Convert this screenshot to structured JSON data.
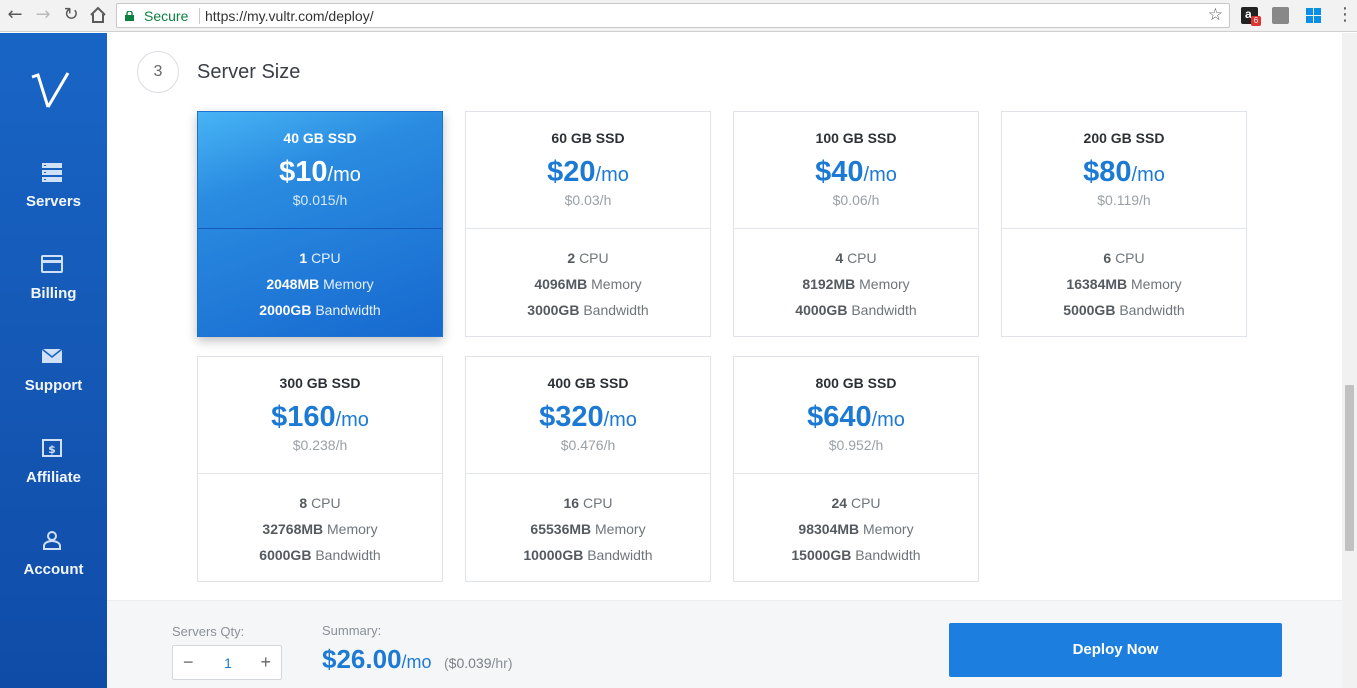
{
  "browser": {
    "secure_label": "Secure",
    "url": "https://my.vultr.com/deploy/",
    "extension_badge": "6"
  },
  "sidebar": {
    "items": [
      {
        "label": "Servers",
        "icon": "servers-icon"
      },
      {
        "label": "Billing",
        "icon": "credit-card-icon"
      },
      {
        "label": "Support",
        "icon": "envelope-icon"
      },
      {
        "label": "Affiliate",
        "icon": "dollar-bill-icon"
      },
      {
        "label": "Account",
        "icon": "user-icon"
      }
    ]
  },
  "section": {
    "step": "3",
    "title": "Server Size"
  },
  "plans": [
    {
      "ssd": "40 GB SSD",
      "price": "$10",
      "per": "/mo",
      "hourly": "$0.015/h",
      "cpu": "1",
      "cpu_label": "CPU",
      "memory": "2048MB",
      "memory_label": "Memory",
      "bandwidth": "2000GB",
      "bandwidth_label": "Bandwidth",
      "selected": true
    },
    {
      "ssd": "60 GB SSD",
      "price": "$20",
      "per": "/mo",
      "hourly": "$0.03/h",
      "cpu": "2",
      "cpu_label": "CPU",
      "memory": "4096MB",
      "memory_label": "Memory",
      "bandwidth": "3000GB",
      "bandwidth_label": "Bandwidth",
      "selected": false
    },
    {
      "ssd": "100 GB SSD",
      "price": "$40",
      "per": "/mo",
      "hourly": "$0.06/h",
      "cpu": "4",
      "cpu_label": "CPU",
      "memory": "8192MB",
      "memory_label": "Memory",
      "bandwidth": "4000GB",
      "bandwidth_label": "Bandwidth",
      "selected": false
    },
    {
      "ssd": "200 GB SSD",
      "price": "$80",
      "per": "/mo",
      "hourly": "$0.119/h",
      "cpu": "6",
      "cpu_label": "CPU",
      "memory": "16384MB",
      "memory_label": "Memory",
      "bandwidth": "5000GB",
      "bandwidth_label": "Bandwidth",
      "selected": false
    },
    {
      "ssd": "300 GB SSD",
      "price": "$160",
      "per": "/mo",
      "hourly": "$0.238/h",
      "cpu": "8",
      "cpu_label": "CPU",
      "memory": "32768MB",
      "memory_label": "Memory",
      "bandwidth": "6000GB",
      "bandwidth_label": "Bandwidth",
      "selected": false
    },
    {
      "ssd": "400 GB SSD",
      "price": "$320",
      "per": "/mo",
      "hourly": "$0.476/h",
      "cpu": "16",
      "cpu_label": "CPU",
      "memory": "65536MB",
      "memory_label": "Memory",
      "bandwidth": "10000GB",
      "bandwidth_label": "Bandwidth",
      "selected": false
    },
    {
      "ssd": "800 GB SSD",
      "price": "$640",
      "per": "/mo",
      "hourly": "$0.952/h",
      "cpu": "24",
      "cpu_label": "CPU",
      "memory": "98304MB",
      "memory_label": "Memory",
      "bandwidth": "15000GB",
      "bandwidth_label": "Bandwidth",
      "selected": false
    }
  ],
  "footer": {
    "qty_label": "Servers Qty:",
    "qty_minus": "−",
    "qty_value": "1",
    "qty_plus": "+",
    "summary_label": "Summary:",
    "summary_price": "$26.00",
    "summary_per": "/mo",
    "summary_hour_open": "(",
    "summary_hour": "$0.039",
    "summary_hour_close": "/hr)",
    "deploy_label": "Deploy Now"
  },
  "colors": {
    "accent": "#1c7ad4",
    "sidebar": "#1558b5",
    "deploy_button": "#1c7fe0"
  }
}
